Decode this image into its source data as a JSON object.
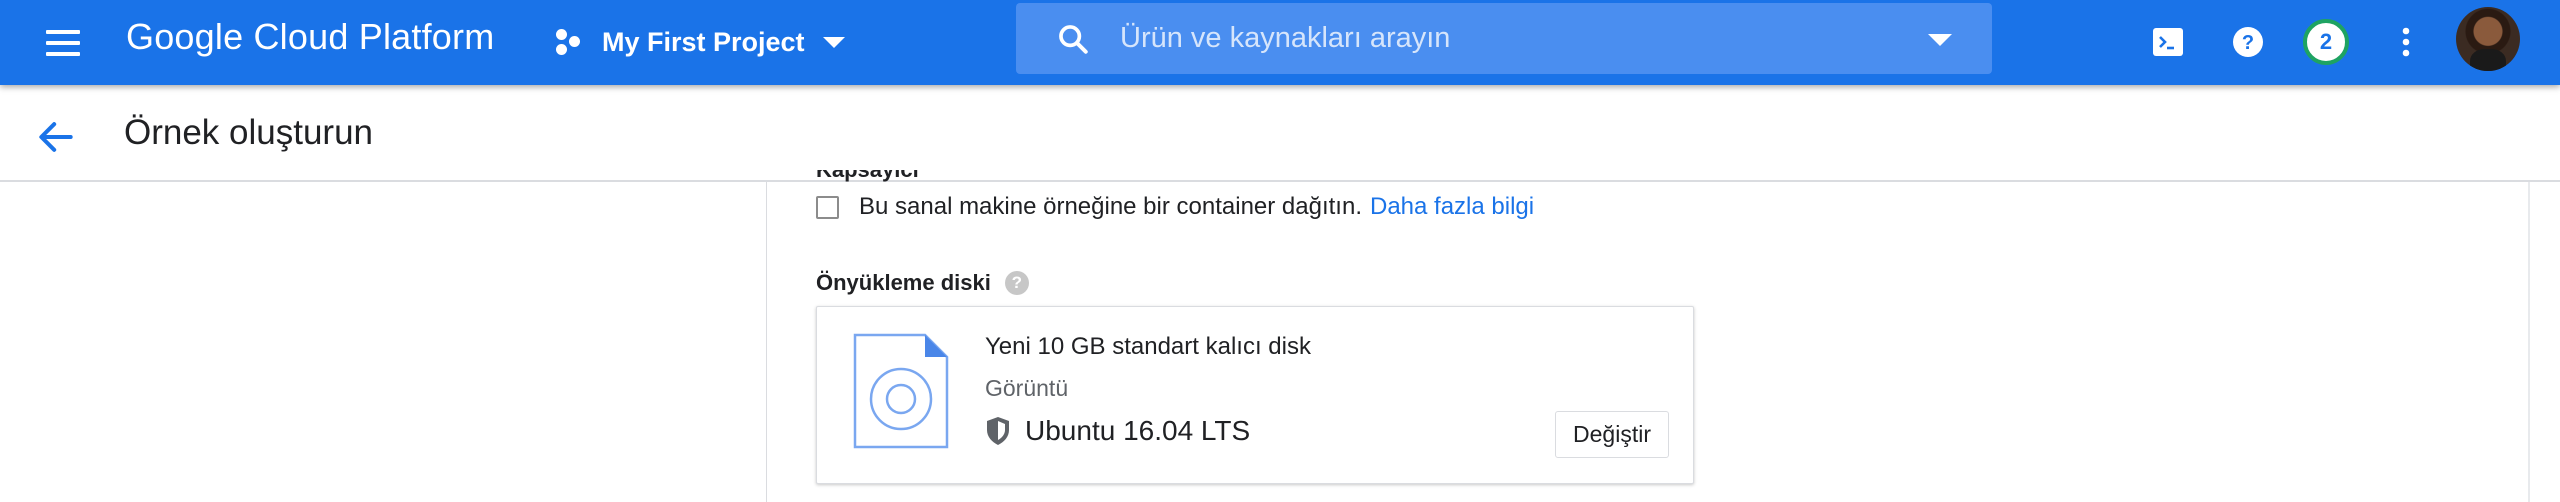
{
  "topbar": {
    "brand": "Google Cloud Platform",
    "project_name": "My First Project",
    "search_placeholder": "Ürün ve kaynakları arayın",
    "notification_count": "2",
    "icons": [
      "menu-icon",
      "project-icon",
      "search-icon",
      "dropdown-icon",
      "cloud-shell-icon",
      "help-icon",
      "more-vert-icon",
      "avatar"
    ],
    "brand_color": "#1a73e8"
  },
  "subheader": {
    "title": "Örnek oluşturun"
  },
  "content": {
    "cut_label": "Kapsayıcı",
    "container_checkbox_label": "Bu sanal makine örneğine bir container dağıtın.",
    "learn_more": "Daha fazla bilgi",
    "boot_disk_label": "Önyükleme diski",
    "disk": {
      "title": "Yeni 10 GB standart kalıcı disk",
      "image_label": "Görüntü",
      "os": "Ubuntu 16.04 LTS",
      "change_button": "Değiştir"
    }
  }
}
